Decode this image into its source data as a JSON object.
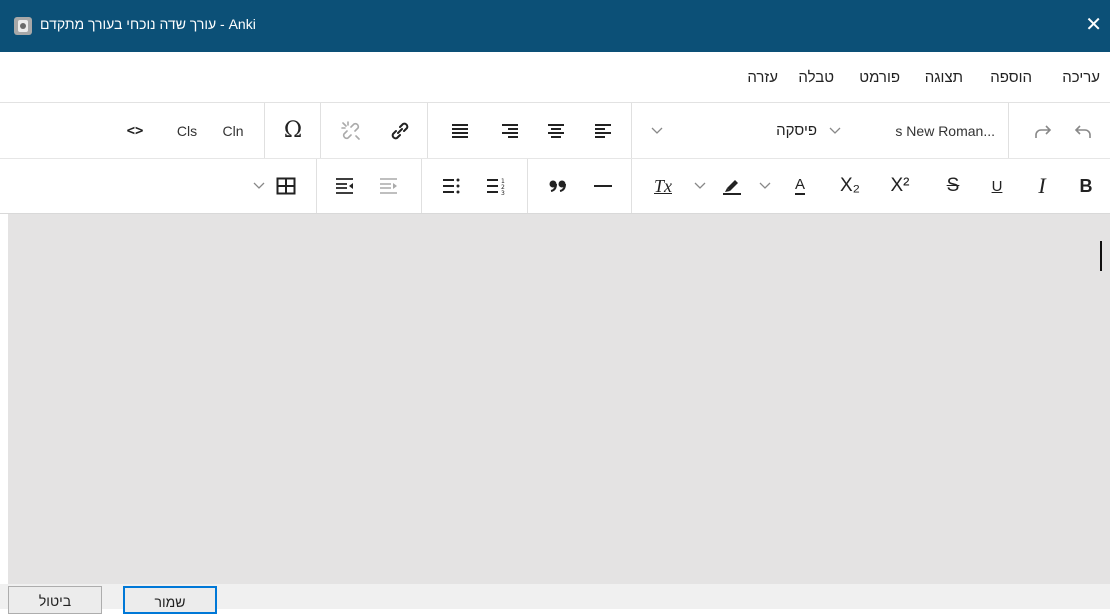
{
  "window": {
    "title": "עורך שדה נוכחי בעורך מתקדם - Anki",
    "close_glyph": "✕",
    "titlebar_color": "#0c5077"
  },
  "menu": {
    "items": [
      "עריכה",
      "הוספה",
      "תצוגה",
      "פורמט",
      "טבלה",
      "עזרה"
    ]
  },
  "toolbar": {
    "font_name": "s New Roman...",
    "block_format": "פיסקה",
    "cls_label": "Cls",
    "cln_label": "Cln",
    "code_glyph": "<>",
    "omega_glyph": "Ω",
    "bold_label": "B",
    "italic_label": "I",
    "underline_label": "U",
    "strike_label": "S",
    "superscript_label": "X²",
    "subscript_label": "X₂",
    "font_color_label": "A",
    "clear_format_label": "Tx",
    "icons": [
      "undo-icon",
      "redo-icon",
      "chevron-down-icon",
      "align-left-icon",
      "align-center-icon",
      "align-right-icon",
      "align-justify-icon",
      "link-icon",
      "unlink-icon",
      "special-char-icon",
      "table-icon",
      "indent-icon",
      "outdent-icon",
      "numbered-list-icon",
      "bullet-list-icon",
      "blockquote-icon",
      "horizontal-rule-icon",
      "highlight-icon"
    ]
  },
  "buttons": {
    "save": "שמור",
    "cancel": "ביטול"
  },
  "colors": {
    "editor_bg": "#e4e3e3",
    "accent": "#0078d7"
  }
}
